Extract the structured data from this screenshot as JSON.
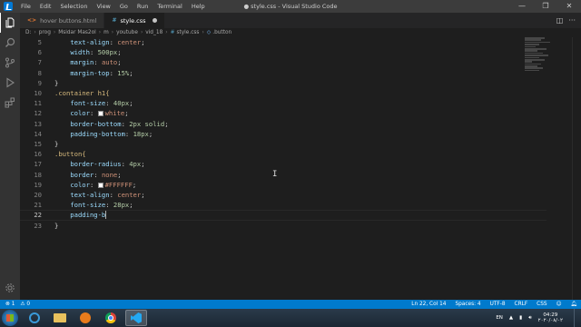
{
  "titlebar": {
    "menu": [
      "File",
      "Edit",
      "Selection",
      "View",
      "Go",
      "Run",
      "Terminal",
      "Help"
    ],
    "title": "● style.css - Visual Studio Code",
    "controls": [
      "—",
      "❐",
      "✕"
    ]
  },
  "activitybar": {
    "icons": [
      "files-icon",
      "search-icon",
      "source-control-icon",
      "run-debug-icon",
      "extensions-icon"
    ],
    "settings_icon": "gear-icon"
  },
  "tabs": [
    {
      "label": "hover buttons.html",
      "type": "html",
      "active": false
    },
    {
      "label": "style.css",
      "type": "css",
      "active": true,
      "modified": true
    }
  ],
  "breadcrumb": [
    "D:",
    "prog",
    "Msidar Mas2ol",
    "m",
    "youtube",
    "vid_18",
    "style.css",
    ".button"
  ],
  "editor": {
    "current_line": 22,
    "lines": [
      {
        "n": "5",
        "indent": "    ",
        "prop": "text-align",
        "val": "center",
        "type": "plain"
      },
      {
        "n": "6",
        "indent": "    ",
        "prop": "width",
        "val": "500px",
        "type": "num"
      },
      {
        "n": "7",
        "indent": "    ",
        "prop": "margin",
        "val": "auto",
        "type": "plain"
      },
      {
        "n": "8",
        "indent": "    ",
        "prop": "margin-top",
        "val": "15%",
        "type": "num"
      },
      {
        "n": "9",
        "text": "}",
        "type": "punc"
      },
      {
        "n": "10",
        "text": ".container h1{",
        "type": "selector"
      },
      {
        "n": "11",
        "indent": "    ",
        "prop": "font-size",
        "val": "40px",
        "type": "num"
      },
      {
        "n": "12",
        "indent": "    ",
        "prop": "color",
        "val": "white",
        "type": "color"
      },
      {
        "n": "13",
        "indent": "    ",
        "prop": "border-bottom",
        "val": "2px solid",
        "type": "num"
      },
      {
        "n": "14",
        "indent": "    ",
        "prop": "padding-bottom",
        "val": "18px",
        "type": "num"
      },
      {
        "n": "15",
        "text": "}",
        "type": "punc"
      },
      {
        "n": "16",
        "text": ".button{",
        "type": "selector"
      },
      {
        "n": "17",
        "indent": "    ",
        "prop": "border-radius",
        "val": "4px",
        "type": "num"
      },
      {
        "n": "18",
        "indent": "    ",
        "prop": "border",
        "val": "none",
        "type": "plain"
      },
      {
        "n": "19",
        "indent": "    ",
        "prop": "color",
        "val": "#FFFFFF",
        "type": "color"
      },
      {
        "n": "20",
        "indent": "    ",
        "prop": "text-align",
        "val": "center",
        "type": "plain"
      },
      {
        "n": "21",
        "indent": "    ",
        "prop": "font-size",
        "val": "28px",
        "type": "num"
      },
      {
        "n": "22",
        "text": "    padding-b",
        "type": "typing"
      },
      {
        "n": "23",
        "text": "}",
        "type": "punc"
      }
    ]
  },
  "statusbar": {
    "errors": "⊗ 1",
    "warnings": "⚠ 0",
    "position": "Ln 22, Col 14",
    "spaces": "Spaces: 4",
    "encoding": "UTF-8",
    "eol": "CRLF",
    "language": "CSS"
  },
  "taskbar": {
    "apps": [
      "internet-explorer-icon",
      "folder-icon",
      "media-player-icon",
      "chrome-icon",
      "vscode-icon"
    ],
    "lang": "EN",
    "time": "04:29",
    "date": "٢٠٢٠/٠٨/٠٢"
  },
  "colors": {
    "accent": "#007acc",
    "editor_bg": "#1e1e1e",
    "property": "#9cdcfe",
    "value": "#ce9178",
    "number": "#b5cea8",
    "selector": "#d7ba7d"
  }
}
